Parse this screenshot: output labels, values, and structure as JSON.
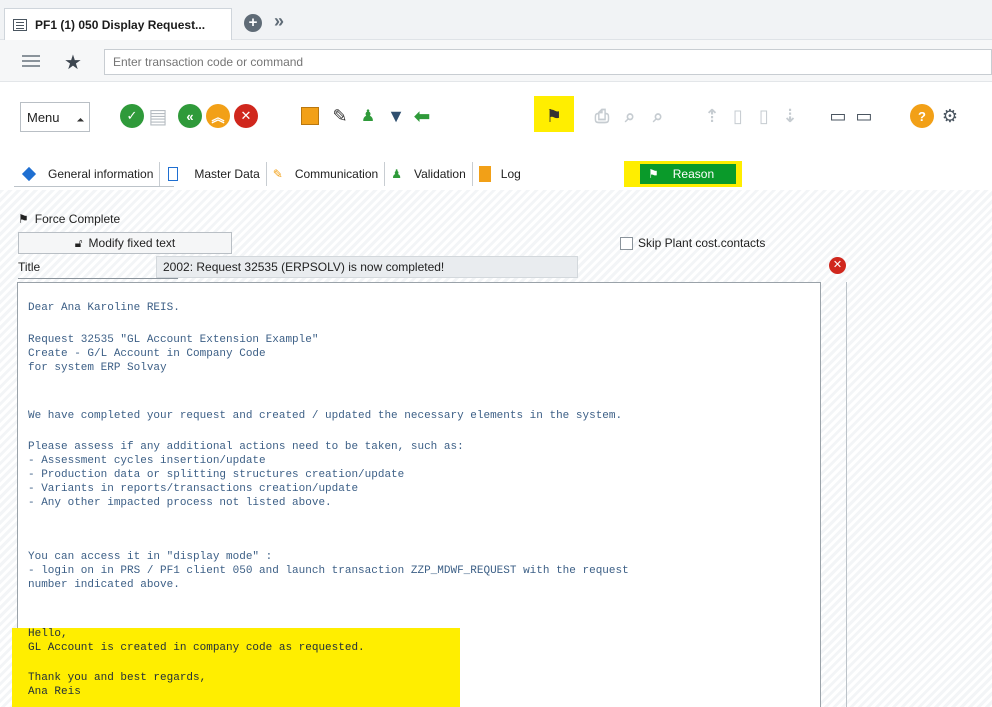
{
  "window": {
    "tab_title": "PF1 (1) 050 Display Request..."
  },
  "command": {
    "placeholder": "Enter transaction code or command"
  },
  "toolbar": {
    "menu_label": "Menu"
  },
  "tabs": [
    {
      "label": "General information"
    },
    {
      "label": "Master Data"
    },
    {
      "label": "Communication"
    },
    {
      "label": "Validation"
    },
    {
      "label": "Log"
    },
    {
      "label": "Reason"
    }
  ],
  "form": {
    "force_complete": "Force Complete",
    "modify_fixed_text": "Modify fixed text",
    "skip_plant": "Skip Plant cost.contacts",
    "title_label": "Title",
    "title_value": "2002: Request 32535 (ERPSOLV) is now completed!"
  },
  "body": {
    "lines": [
      "Dear Ana Karoline REIS.",
      "Request 32535 \"GL Account Extension Example\"",
      "Create - G/L Account in Company Code",
      "for system ERP Solvay",
      "We have completed your request and created / updated the necessary elements in the system.",
      "Please assess if any additional actions need to be taken, such as:",
      "- Assessment cycles insertion/update",
      "- Production data or splitting structures creation/update",
      "- Variants in reports/transactions creation/update",
      "- Any other impacted process not listed above.",
      "You can access it in \"display mode\" :",
      "- login on in PRS / PF1 client 050 and launch transaction ZZP_MDWF_REQUEST with the request",
      "number indicated above.",
      "Hello,",
      "GL Account is created in company code as requested.",
      "Thank you and best regards,",
      "Ana Reis"
    ]
  },
  "colors": {
    "highlight": "#ffee00",
    "reason_tab": "#0a9a2a",
    "accent_green": "#2f9a3a",
    "close_red": "#d0271d"
  }
}
